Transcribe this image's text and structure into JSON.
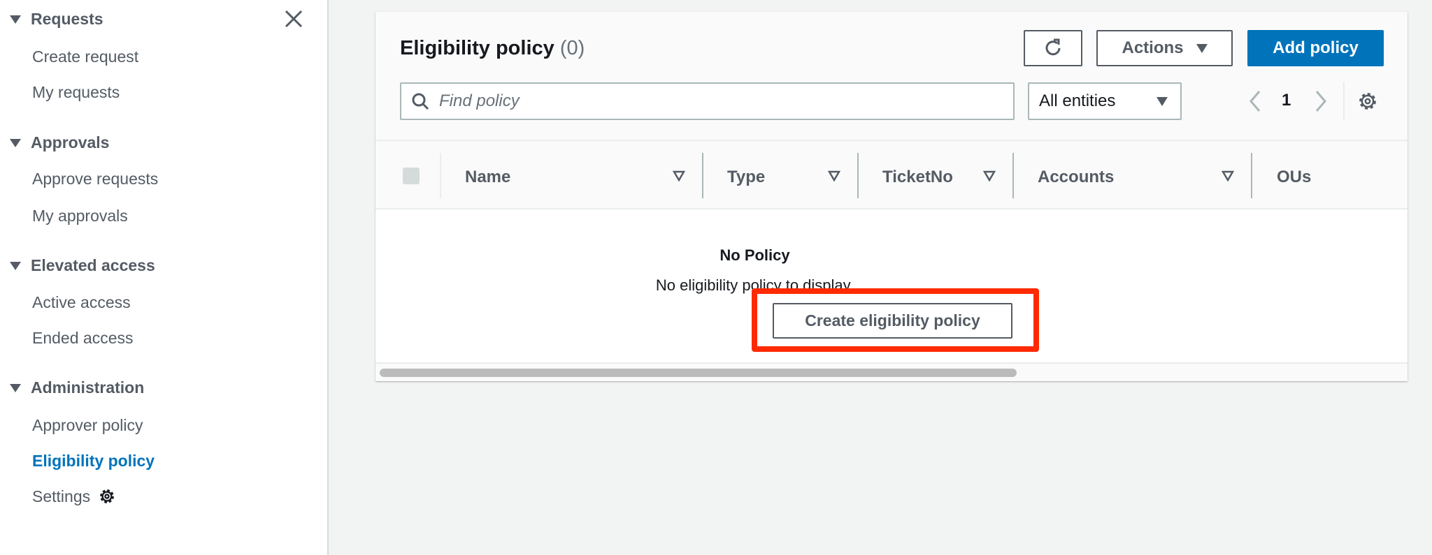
{
  "sidebar": {
    "sections": [
      {
        "label": "Requests",
        "items": [
          "Create request",
          "My requests"
        ]
      },
      {
        "label": "Approvals",
        "items": [
          "Approve requests",
          "My approvals"
        ]
      },
      {
        "label": "Elevated access",
        "items": [
          "Active access",
          "Ended access"
        ]
      },
      {
        "label": "Administration",
        "items": [
          "Approver policy",
          "Eligibility policy",
          "Settings"
        ]
      }
    ],
    "active_item": "Eligibility policy"
  },
  "panel": {
    "title": "Eligibility policy",
    "count": "(0)",
    "actions_label": "Actions",
    "add_label": "Add policy",
    "search_placeholder": "Find policy",
    "filter_value": "All entities",
    "page": "1",
    "columns": [
      "Name",
      "Type",
      "TicketNo",
      "Accounts",
      "OUs"
    ],
    "empty_title": "No Policy",
    "empty_text": "No eligibility policy to display.",
    "create_label": "Create eligibility policy"
  },
  "colors": {
    "accent": "#0073bb",
    "highlight": "#ff2a00"
  }
}
